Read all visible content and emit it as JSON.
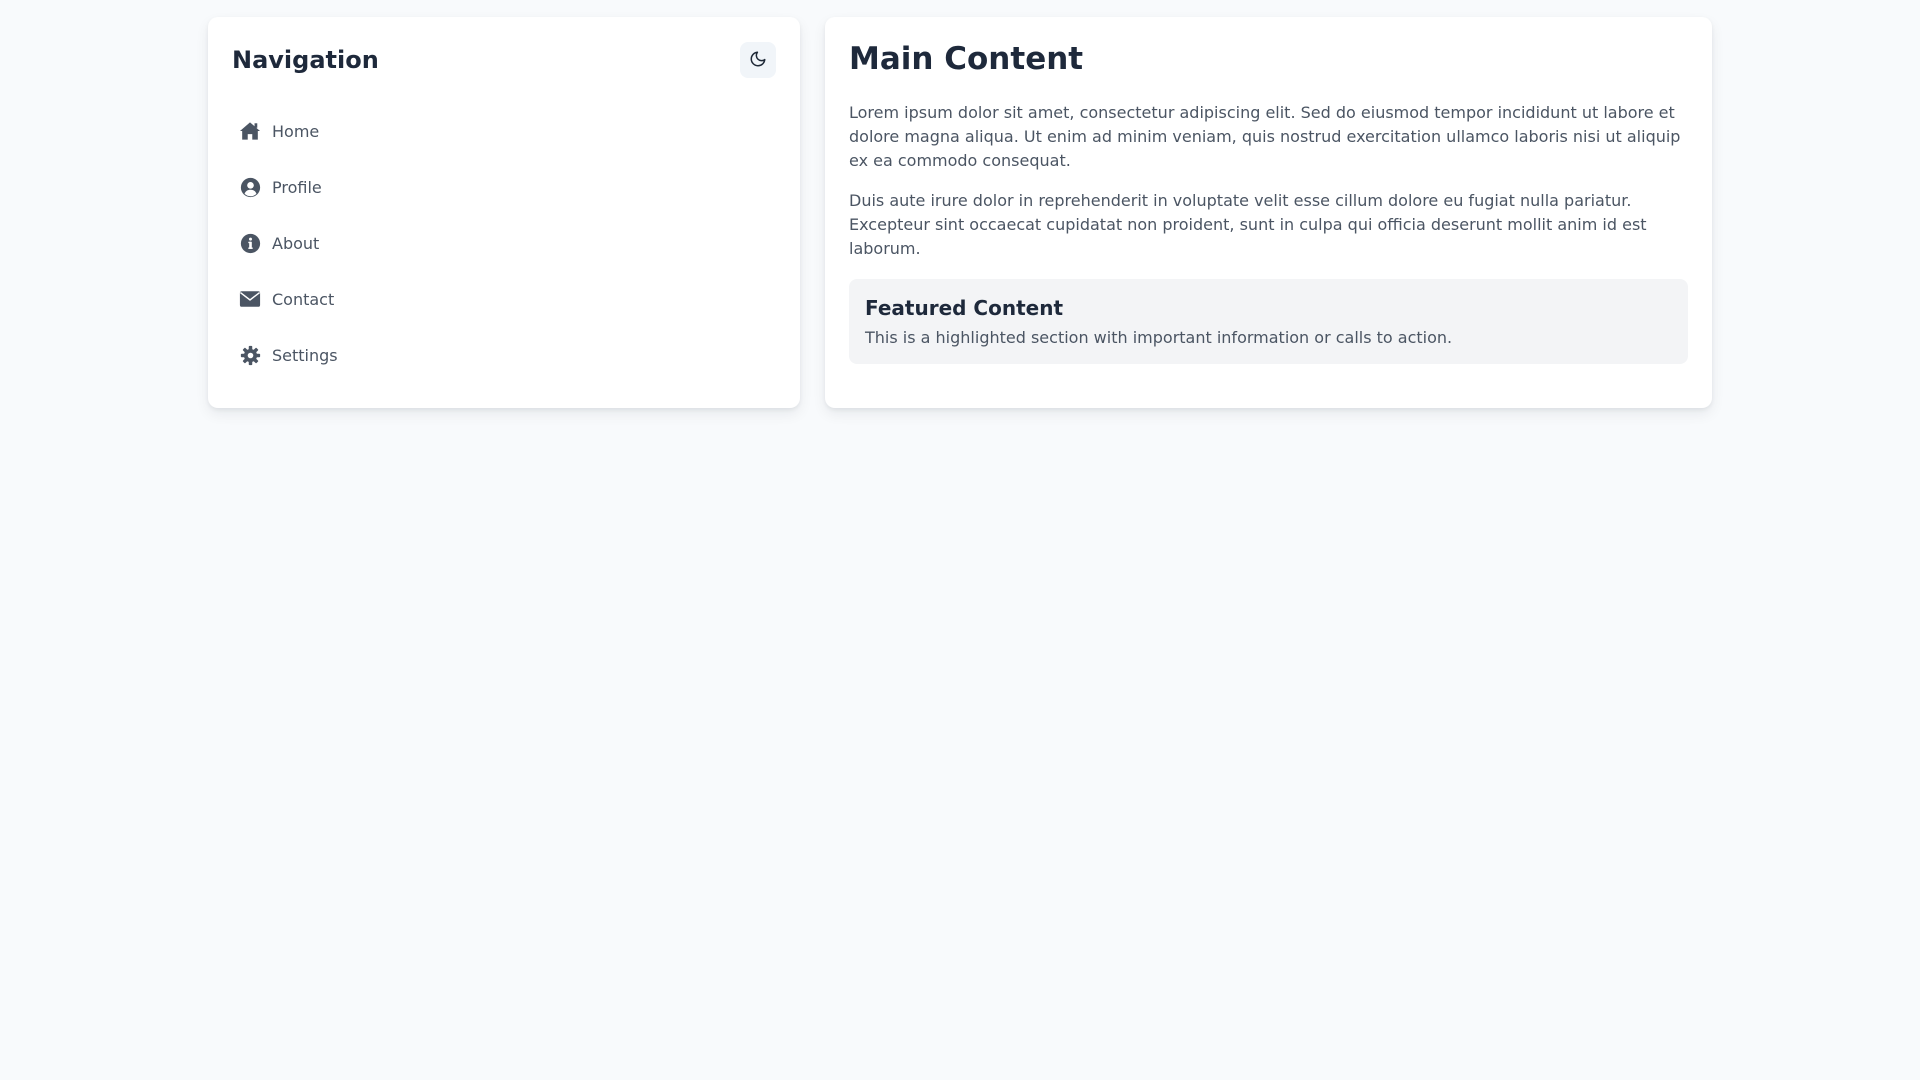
{
  "nav": {
    "title": "Navigation",
    "theme_toggle_icon": "moon-icon",
    "items": [
      {
        "label": "Home",
        "icon": "home-icon"
      },
      {
        "label": "Profile",
        "icon": "user-circle-icon"
      },
      {
        "label": "About",
        "icon": "info-circle-icon"
      },
      {
        "label": "Contact",
        "icon": "envelope-icon"
      },
      {
        "label": "Settings",
        "icon": "gear-icon"
      }
    ]
  },
  "main": {
    "title": "Main Content",
    "paragraphs": [
      "Lorem ipsum dolor sit amet, consectetur adipiscing elit. Sed do eiusmod tempor incididunt ut labore et dolore magna aliqua. Ut enim ad minim veniam, quis nostrud exercitation ullamco laboris nisi ut aliquip ex ea commodo consequat.",
      "Duis aute irure dolor in reprehenderit in voluptate velit esse cillum dolore eu fugiat nulla pariatur. Excepteur sint occaecat cupidatat non proident, sunt in culpa qui officia deserunt mollit anim id est laborum."
    ],
    "featured": {
      "title": "Featured Content",
      "text": "This is a highlighted section with important information or calls to action."
    }
  },
  "colors": {
    "background": "#f8fafc",
    "card": "#ffffff",
    "heading": "#1e293b",
    "body_text": "#4b5563",
    "icon": "#4b5563",
    "featured_bg": "#f3f4f6"
  }
}
